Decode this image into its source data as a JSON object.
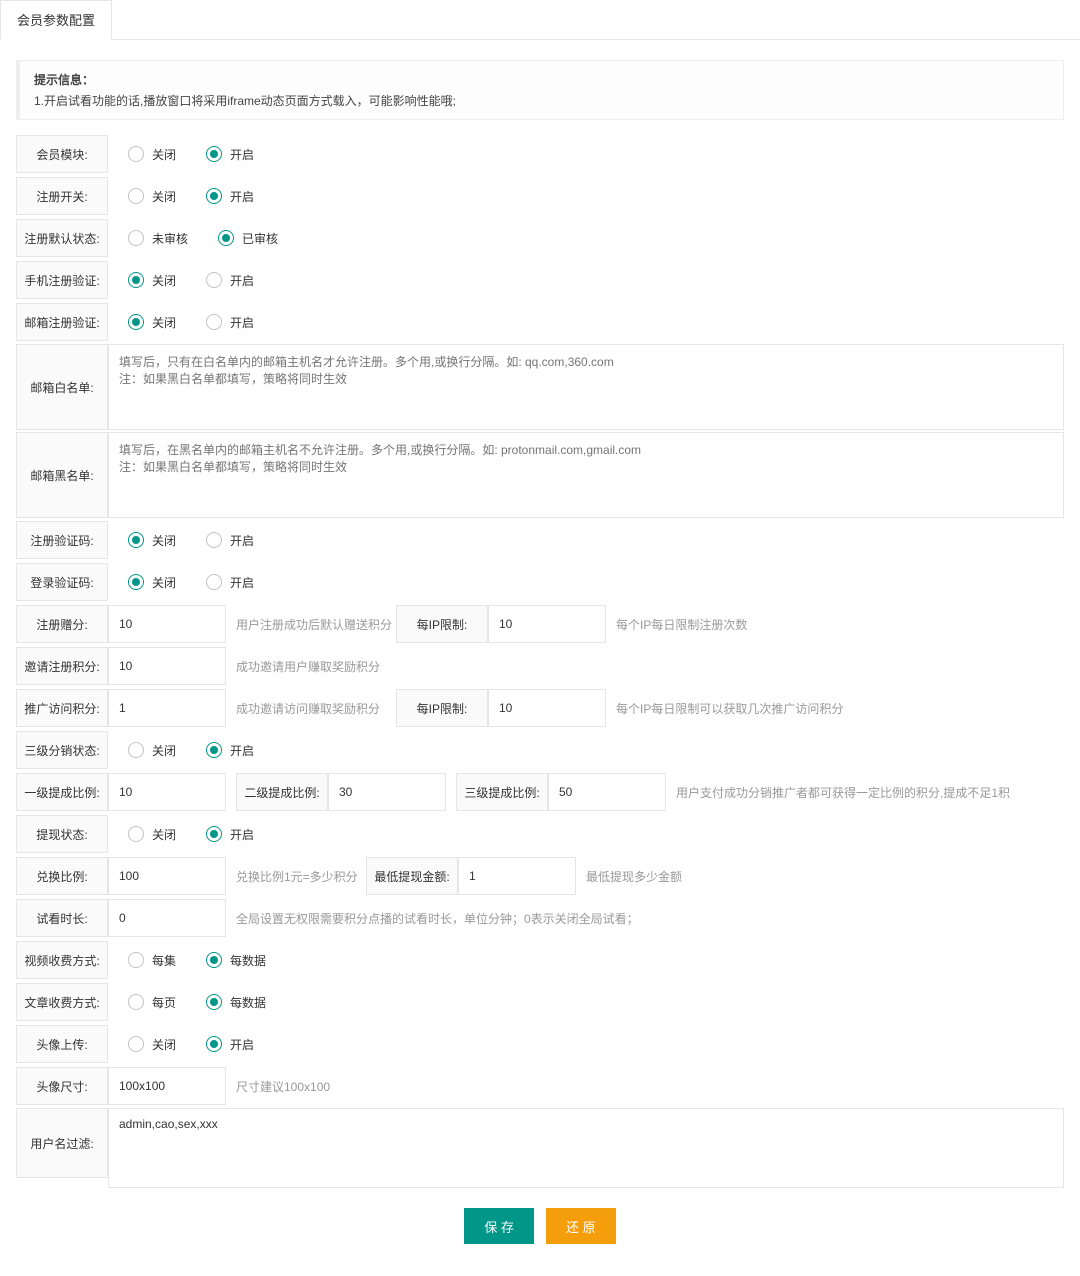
{
  "tab": "会员参数配置",
  "tip": {
    "title": "提示信息：",
    "line1": "1.开启试看功能的话,播放窗口将采用iframe动态页面方式载入，可能影响性能哦;"
  },
  "labels": {
    "member_module": "会员模块:",
    "register_switch": "注册开关:",
    "register_default_status": "注册默认状态:",
    "phone_reg_verify": "手机注册验证:",
    "email_reg_verify": "邮箱注册验证:",
    "email_whitelist": "邮箱白名单:",
    "email_blacklist": "邮箱黑名单:",
    "register_captcha": "注册验证码:",
    "login_captcha": "登录验证码:",
    "register_points": "注册赠分:",
    "invite_register_points": "邀请注册积分:",
    "promote_visit_points": "推广访问积分:",
    "three_level_status": "三级分销状态:",
    "level1_ratio": "一级提成比例:",
    "level2_ratio": "二级提成比例:",
    "level3_ratio": "三级提成比例:",
    "withdraw_status": "提现状态:",
    "exchange_ratio": "兑换比例:",
    "min_withdraw": "最低提现金额:",
    "preview_duration": "试看时长:",
    "video_charge_mode": "视频收费方式:",
    "article_charge_mode": "文章收费方式:",
    "avatar_upload": "头像上传:",
    "avatar_size": "头像尺寸:",
    "username_filter": "用户名过滤:",
    "ip_limit": "每IP限制:"
  },
  "options": {
    "close": "关闭",
    "open": "开启",
    "unreviewed": "未审核",
    "reviewed": "已审核",
    "per_episode": "每集",
    "per_data": "每数据",
    "per_page": "每页"
  },
  "placeholders": {
    "whitelist": "填写后，只有在白名单内的邮箱主机名才允许注册。多个用,或换行分隔。如: qq.com,360.com\n注：如果黑白名单都填写，策略将同时生效",
    "blacklist": "填写后，在黑名单内的邮箱主机名不允许注册。多个用,或换行分隔。如: protonmail.com,gmail.com\n注：如果黑白名单都填写，策略将同时生效"
  },
  "values": {
    "register_points": "10",
    "ip_limit_register": "10",
    "invite_register_points": "10",
    "promote_visit_points": "1",
    "ip_limit_promote": "10",
    "level1_ratio": "10",
    "level2_ratio": "30",
    "level3_ratio": "50",
    "exchange_ratio": "100",
    "min_withdraw": "1",
    "preview_duration": "0",
    "avatar_size": "100x100",
    "username_filter": "admin,cao,sex,xxx"
  },
  "hints": {
    "register_points": "用户注册成功后默认赠送积分",
    "ip_limit_register": "每个IP每日限制注册次数",
    "invite_register_points": "成功邀请用户赚取奖励积分",
    "promote_visit_points": "成功邀请访问赚取奖励积分",
    "ip_limit_promote": "每个IP每日限制可以获取几次推广访问积分",
    "level_ratio": "用户支付成功分销推广者都可获得一定比例的积分,提成不足1积",
    "exchange_ratio": "兑换比例1元=多少积分",
    "min_withdraw": "最低提现多少金额",
    "preview_duration": "全局设置无权限需要积分点播的试看时长，单位分钟；0表示关闭全局试看；",
    "avatar_size": "尺寸建议100x100"
  },
  "buttons": {
    "save": "保 存",
    "reset": "还 原"
  }
}
